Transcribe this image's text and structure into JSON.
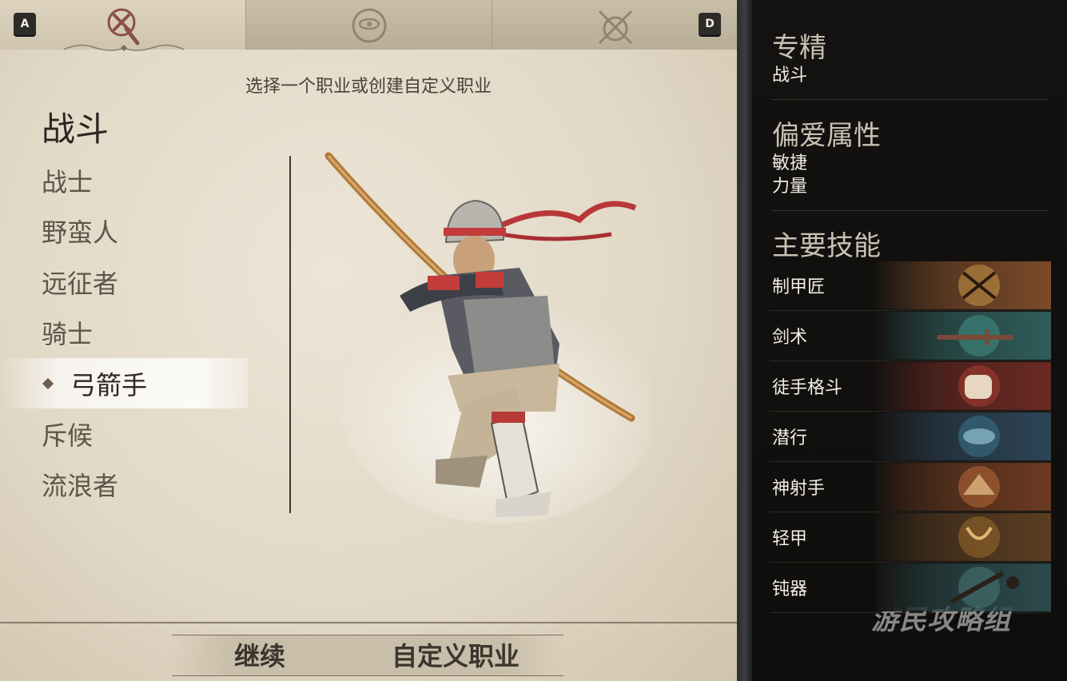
{
  "tabs": {
    "left_key": "A",
    "right_key": "D",
    "items": [
      {
        "icon": "axe-emblem-icon",
        "active": true
      },
      {
        "icon": "eye-emblem-icon",
        "active": false
      },
      {
        "icon": "crossed-swords-emblem-icon",
        "active": false
      }
    ]
  },
  "main": {
    "subtitle": "选择一个职业或创建自定义职业",
    "category": "战斗",
    "classes": [
      "战士",
      "野蛮人",
      "远征者",
      "骑士",
      "弓箭手",
      "斥候",
      "流浪者"
    ],
    "selected_class": "弓箭手"
  },
  "footer": {
    "continue_label": "继续",
    "custom_label": "自定义职业"
  },
  "details": {
    "specialization_title": "专精",
    "specialization_value": "战斗",
    "attributes_title": "偏爱属性",
    "attributes": [
      "敏捷",
      "力量"
    ],
    "skills_title": "主要技能",
    "skills": [
      {
        "name": "制甲匠",
        "icon": "armorer-emblem-icon",
        "color": "#7a4a2a"
      },
      {
        "name": "剑术",
        "icon": "sword-emblem-icon",
        "color": "#2f5d5a"
      },
      {
        "name": "徒手格斗",
        "icon": "fist-emblem-icon",
        "color": "#6b2a24"
      },
      {
        "name": "潜行",
        "icon": "sneak-emblem-icon",
        "color": "#2d4456"
      },
      {
        "name": "神射手",
        "icon": "marksman-emblem-icon",
        "color": "#6c3a22"
      },
      {
        "name": "轻甲",
        "icon": "light-armor-emblem-icon",
        "color": "#5a3e22"
      },
      {
        "name": "钝器",
        "icon": "blunt-emblem-icon",
        "color": "#2c4a4c"
      }
    ]
  },
  "watermark": "游民攻略组"
}
